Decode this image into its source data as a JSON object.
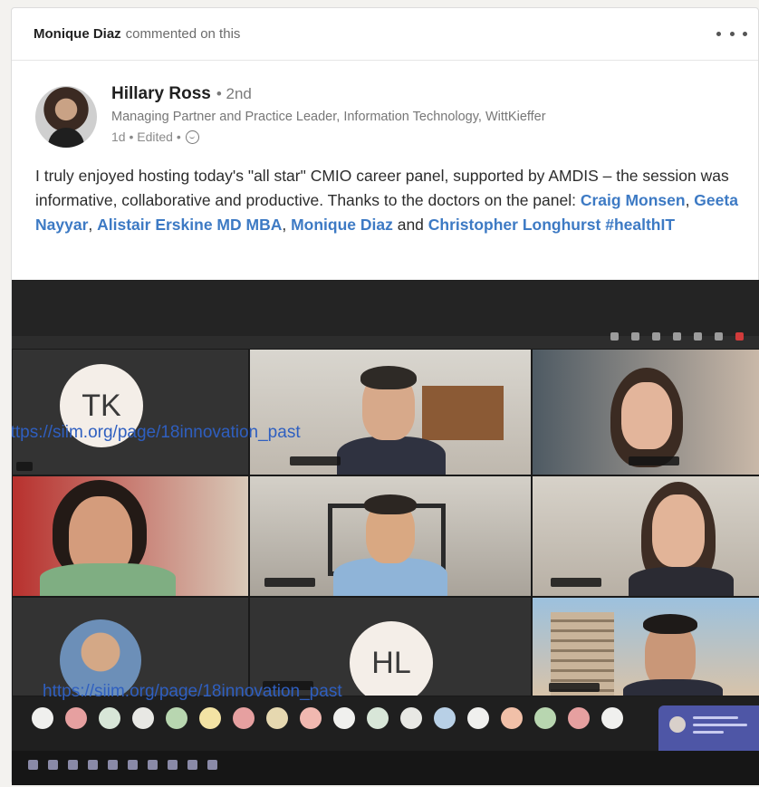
{
  "activity": {
    "actor": "Monique Diaz",
    "action": "commented on this"
  },
  "post": {
    "author_name": "Hillary Ross",
    "degree": "• 2nd",
    "headline": "Managing Partner and Practice Leader, Information Technology, WittKieffer",
    "meta": "1d • Edited •",
    "text_1": "I truly enjoyed hosting today's \"all star\" CMIO career panel, supported by AMDIS – the session was informative, collaborative and productive. Thanks to the doctors on the panel: ",
    "mentions": [
      "Craig Monsen",
      "Geeta Nayyar",
      "Alistair Erskine MD MBA",
      "Monique Diaz",
      "Christopher Longhurst"
    ],
    "separator": ", ",
    "and_text": " and ",
    "hashtag": "#healthIT"
  },
  "video": {
    "tile_initials_1": "TK",
    "tile_initials_2": "HL"
  },
  "watermark": {
    "url": "https://siim.org/page/18innovation_past"
  },
  "colors": {
    "link": "#3d7ac4",
    "watermark": "#2f5fc0",
    "card_bg": "#ffffff",
    "page_bg": "#f3f2ef"
  },
  "icons": {
    "more": "more-horizontal-icon",
    "visibility": "globe-icon"
  }
}
